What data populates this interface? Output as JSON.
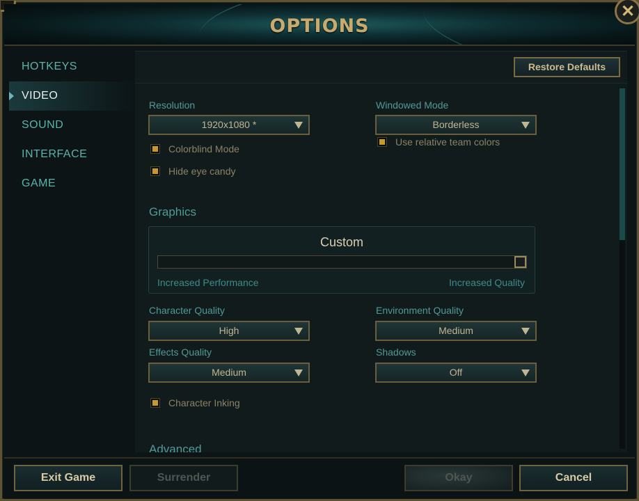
{
  "window": {
    "title": "OPTIONS",
    "close_glyph": "✕",
    "accent_gold": "#c8aa6e",
    "accent_teal": "#5bb3ac"
  },
  "sidebar": {
    "items": [
      {
        "label": "HOTKEYS",
        "active": false
      },
      {
        "label": "VIDEO",
        "active": true
      },
      {
        "label": "SOUND",
        "active": false
      },
      {
        "label": "INTERFACE",
        "active": false
      },
      {
        "label": "GAME",
        "active": false
      }
    ]
  },
  "content": {
    "restore_defaults": "Restore Defaults",
    "resolution": {
      "label": "Resolution",
      "value": "1920x1080 *"
    },
    "windowed_mode": {
      "label": "Windowed Mode",
      "value": "Borderless"
    },
    "checkboxes_top": {
      "colorblind": {
        "label": "Colorblind Mode",
        "checked": true
      },
      "hide_eye_candy": {
        "label": "Hide eye candy",
        "checked": true
      },
      "relative_team_colors": {
        "label": "Use relative team colors",
        "checked": true
      }
    },
    "graphics": {
      "title": "Graphics",
      "preset": "Custom",
      "left_label": "Increased Performance",
      "right_label": "Increased Quality",
      "level_fraction": 1.0
    },
    "character_quality": {
      "label": "Character Quality",
      "value": "High"
    },
    "environment_quality": {
      "label": "Environment Quality",
      "value": "Medium"
    },
    "effects_quality": {
      "label": "Effects Quality",
      "value": "Medium"
    },
    "shadows": {
      "label": "Shadows",
      "value": "Off"
    },
    "character_inking": {
      "label": "Character Inking",
      "checked": true
    },
    "advanced_title": "Advanced"
  },
  "footer": {
    "exit_game": "Exit Game",
    "surrender": "Surrender",
    "okay": "Okay",
    "cancel": "Cancel"
  }
}
